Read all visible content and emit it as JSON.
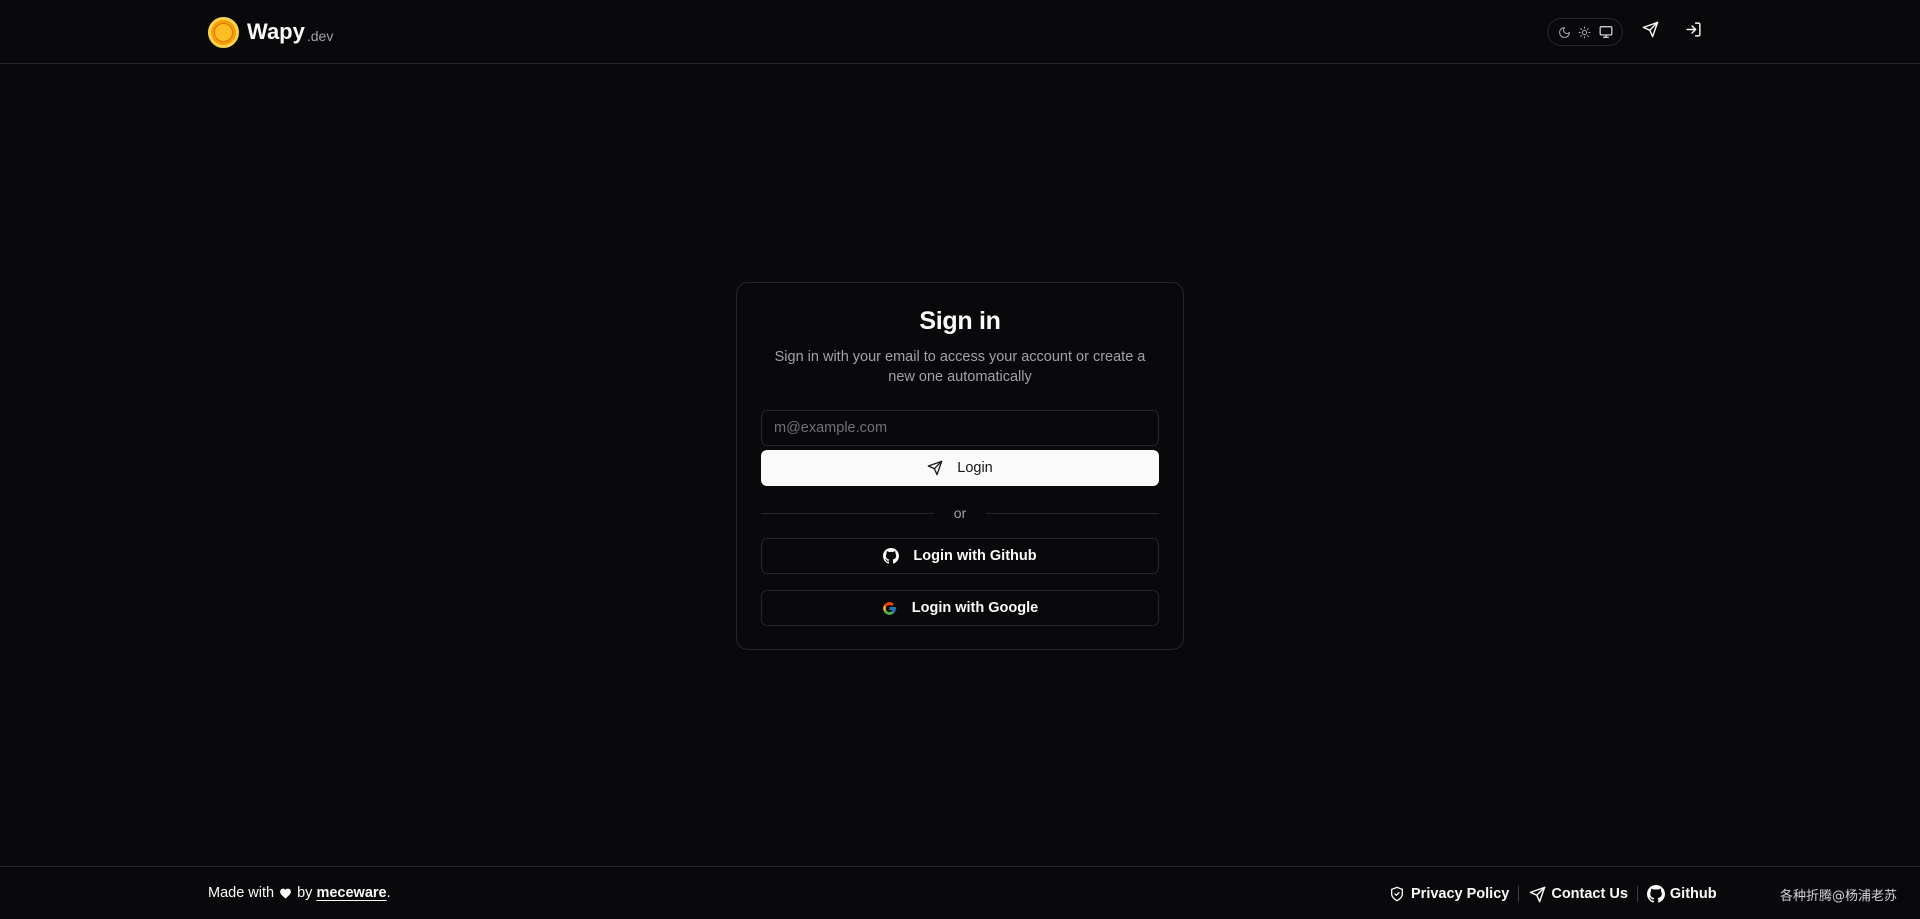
{
  "header": {
    "logo_name": "Wapy",
    "logo_suffix": ".dev",
    "theme_icons": [
      "moon-icon",
      "sun-icon",
      "monitor-icon"
    ],
    "contact_icon": "send-icon",
    "login_icon": "log-in-icon"
  },
  "signin": {
    "title": "Sign in",
    "description": "Sign in with your email to access your account or create a new one automatically",
    "email_placeholder": "m@example.com",
    "email_value": "",
    "login_label": "Login",
    "divider_label": "or",
    "github_label": "Login with Github",
    "google_label": "Login with Google"
  },
  "footer": {
    "made_with": "Made with",
    "by": "by",
    "brand": "meceware",
    "period": ".",
    "links": [
      {
        "label": "Privacy Policy",
        "icon": "shield-check-icon"
      },
      {
        "label": "Contact Us",
        "icon": "send-icon"
      },
      {
        "label": "Github",
        "icon": "github-icon"
      }
    ],
    "watermark": "各种折腾@杨浦老苏"
  },
  "colors": {
    "background": "#09090b",
    "border": "#27272a",
    "muted_text": "#a1a1aa",
    "primary_button": "#fafafa",
    "logo_accent": "#f59e0b"
  }
}
